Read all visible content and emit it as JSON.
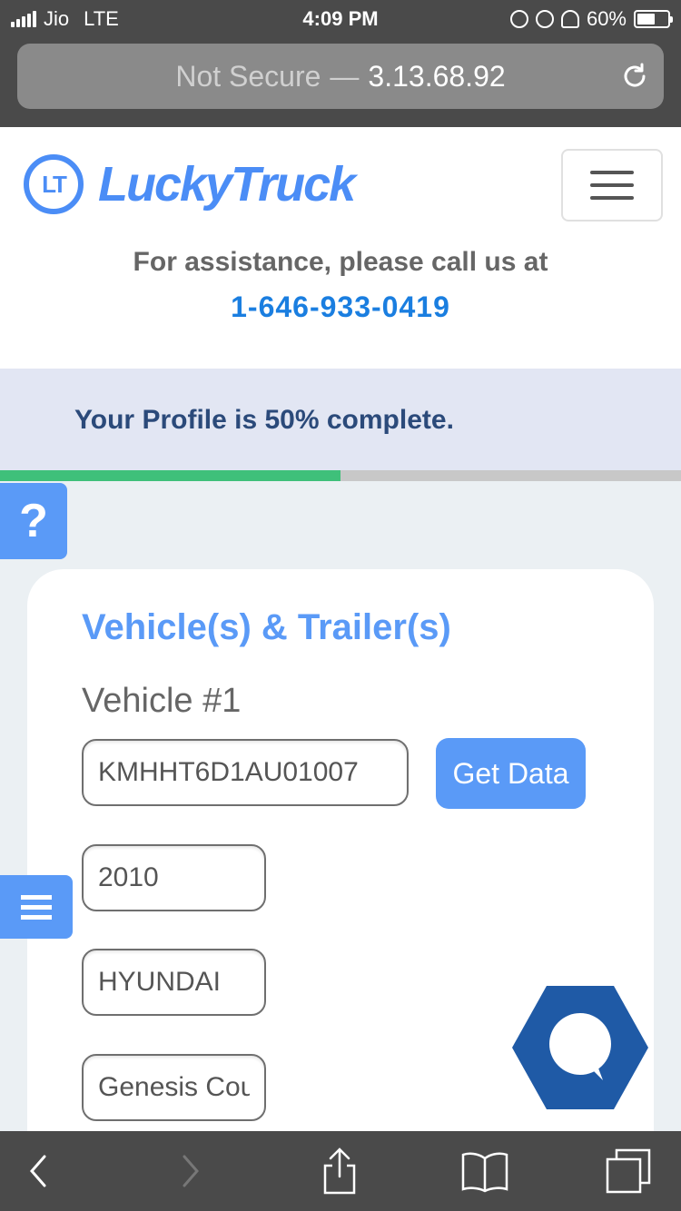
{
  "status_bar": {
    "carrier": "Jio",
    "network": "LTE",
    "time": "4:09 PM",
    "battery": "60%",
    "battery_level": 0.6
  },
  "browser": {
    "security": "Not Secure",
    "separator": "—",
    "host": "3.13.68.92"
  },
  "header": {
    "logo_mark": "LT",
    "logo_text": "LuckyTruck",
    "assistance_text": "For assistance, please call us at",
    "phone": "1-646-933-0419"
  },
  "profile": {
    "banner_text": "Your Profile is 50% complete.",
    "progress_percent": 50,
    "progress_color": "#3fc07a"
  },
  "help_button": {
    "label": "?"
  },
  "card": {
    "title": "Vehicle(s) & Trailer(s)",
    "vehicle_label": "Vehicle #1",
    "vin_value": "KMHHT6D1AU01007",
    "get_data_label": "Get Data",
    "year_value": "2010",
    "make_value": "HYUNDAI",
    "model_value": "Genesis Cou"
  },
  "colors": {
    "accent": "#5a9af7",
    "brand": "#4b8df6",
    "phone_link": "#1a7ee0",
    "chat_widget": "#1f5aa6"
  },
  "icons": {
    "chat": "chat-bubble-icon",
    "reload": "reload-icon",
    "back": "chevron-left-icon",
    "forward": "chevron-right-icon",
    "share": "share-icon",
    "bookmarks": "book-icon",
    "tabs": "tabs-icon"
  }
}
